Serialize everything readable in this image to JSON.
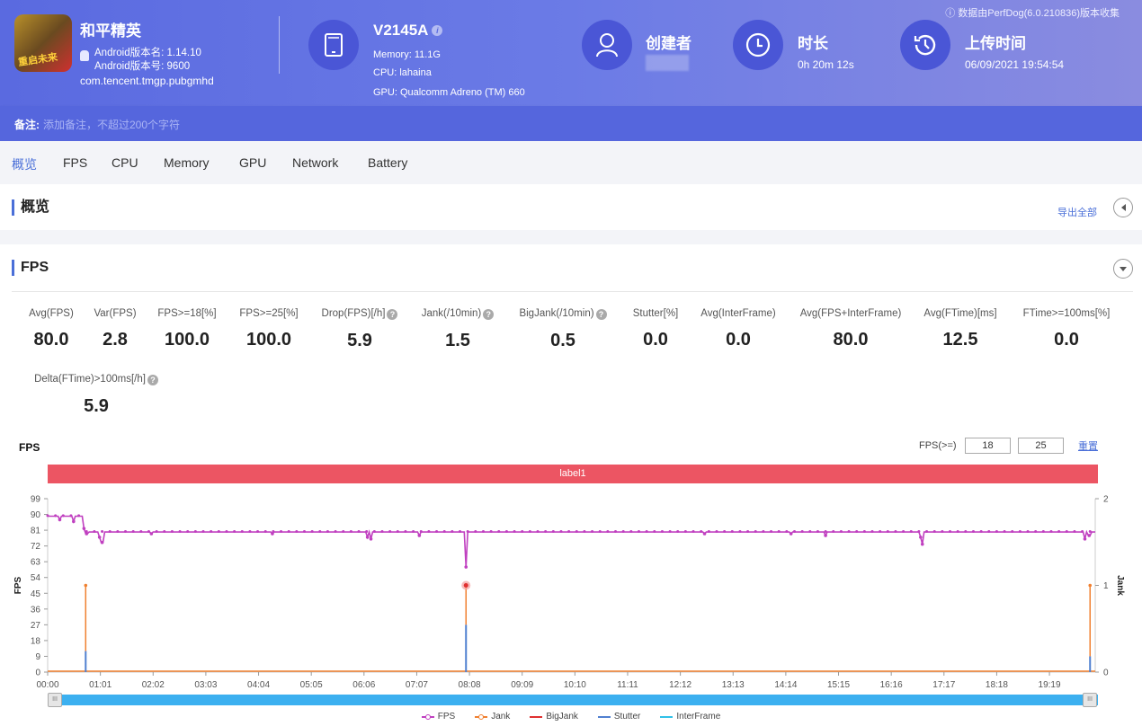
{
  "header": {
    "app_name": "和平精英",
    "app_icon_text": "重启未来",
    "android_version_name": "Android版本名: 1.14.10",
    "android_version_code": "Android版本号: 9600",
    "package": "com.tencent.tmgp.pubgmhd",
    "device": {
      "model": "V2145A",
      "memory": "Memory: 11.1G",
      "cpu": "CPU: lahaina",
      "gpu": "GPU: Qualcomm Adreno (TM) 660"
    },
    "creator": {
      "title": "创建者",
      "value": ""
    },
    "duration": {
      "title": "时长",
      "value": "0h 20m 12s"
    },
    "upload": {
      "title": "上传时间",
      "value": "06/09/2021 19:54:54"
    },
    "collect_note": "数据由PerfDog(6.0.210836)版本收集"
  },
  "notes": {
    "label": "备注:",
    "placeholder": "添加备注，不超过200个字符"
  },
  "tabs": [
    {
      "label": "概览",
      "active": true
    },
    {
      "label": "FPS"
    },
    {
      "label": "CPU"
    },
    {
      "label": "Memory"
    },
    {
      "label": "GPU"
    },
    {
      "label": "Network"
    },
    {
      "label": "Battery"
    }
  ],
  "overview": {
    "title": "概览",
    "export_label": "导出全部"
  },
  "fps_section": {
    "title": "FPS",
    "metrics": [
      {
        "label": "Avg(FPS)",
        "value": "80.0"
      },
      {
        "label": "Var(FPS)",
        "value": "2.8"
      },
      {
        "label": "FPS>=18[%]",
        "value": "100.0"
      },
      {
        "label": "FPS>=25[%]",
        "value": "100.0"
      },
      {
        "label": "Drop(FPS)[/h]",
        "value": "5.9",
        "help": true
      },
      {
        "label": "Jank(/10min)",
        "value": "1.5",
        "help": true
      },
      {
        "label": "BigJank(/10min)",
        "value": "0.5",
        "help": true
      },
      {
        "label": "Stutter[%]",
        "value": "0.0"
      },
      {
        "label": "Avg(InterFrame)",
        "value": "0.0"
      },
      {
        "label": "Avg(FPS+InterFrame)",
        "value": "80.0"
      },
      {
        "label": "Avg(FTime)[ms]",
        "value": "12.5"
      },
      {
        "label": "FTime>=100ms[%]",
        "value": "0.0"
      },
      {
        "label": "Delta(FTime)>100ms[/h]",
        "value": "5.9",
        "help": true
      }
    ],
    "help_glyph": "?"
  },
  "chart_controls": {
    "title": "FPS",
    "fps_threshold_label": "FPS(>=)",
    "threshold_1": "18",
    "threshold_2": "25",
    "reset_label": "重置",
    "label_bar": "label1",
    "handle_glyph": "III"
  },
  "chart_data": {
    "type": "line",
    "title": "FPS",
    "ylabel": "FPS",
    "y2label": "Jank",
    "ylim": [
      0,
      99
    ],
    "y2lim": [
      0,
      2
    ],
    "yticks": [
      0,
      9,
      18,
      27,
      36,
      45,
      54,
      63,
      72,
      81,
      90,
      99
    ],
    "y2ticks": [
      0,
      1,
      2
    ],
    "xticks": [
      "00:00",
      "01:01",
      "02:02",
      "03:03",
      "04:04",
      "05:05",
      "06:06",
      "07:07",
      "08:08",
      "09:09",
      "10:10",
      "11:11",
      "12:12",
      "13:13",
      "14:14",
      "15:15",
      "16:16",
      "17:17",
      "18:18",
      "19:19"
    ],
    "x_range_seconds": [
      0,
      1212
    ],
    "legend_position": "bottom",
    "series": [
      {
        "name": "FPS",
        "color": "#c040c0",
        "axis": "left",
        "baseline_segments": [
          {
            "from": 0,
            "to": 42,
            "value": 89
          },
          {
            "from": 42,
            "to": 1212,
            "value": 80
          }
        ],
        "dips": [
          [
            14,
            87
          ],
          [
            30,
            86
          ],
          [
            42,
            82
          ],
          [
            45,
            79
          ],
          [
            60,
            77
          ],
          [
            63,
            74
          ],
          [
            120,
            79
          ],
          [
            260,
            79
          ],
          [
            370,
            77
          ],
          [
            374,
            76
          ],
          [
            430,
            78
          ],
          [
            484,
            60
          ],
          [
            760,
            79
          ],
          [
            860,
            79
          ],
          [
            900,
            78
          ],
          [
            1010,
            77
          ],
          [
            1012,
            73
          ],
          [
            1200,
            76
          ],
          [
            1205,
            78
          ]
        ]
      },
      {
        "name": "Jank",
        "color": "#f08030",
        "axis": "right",
        "spikes": [
          [
            44,
            1
          ],
          [
            484,
            1
          ],
          [
            1206,
            1
          ]
        ]
      },
      {
        "name": "BigJank",
        "color": "#e03030",
        "axis": "right",
        "spikes": []
      },
      {
        "name": "Stutter",
        "color": "#5080d0",
        "axis": "left",
        "spikes": [
          [
            44,
            12
          ],
          [
            484,
            27
          ],
          [
            1206,
            9
          ]
        ]
      },
      {
        "name": "InterFrame",
        "color": "#30c0e8",
        "axis": "left",
        "spikes": []
      }
    ],
    "highlight_point": {
      "series": "Jank",
      "x": 484,
      "value": 1
    }
  }
}
